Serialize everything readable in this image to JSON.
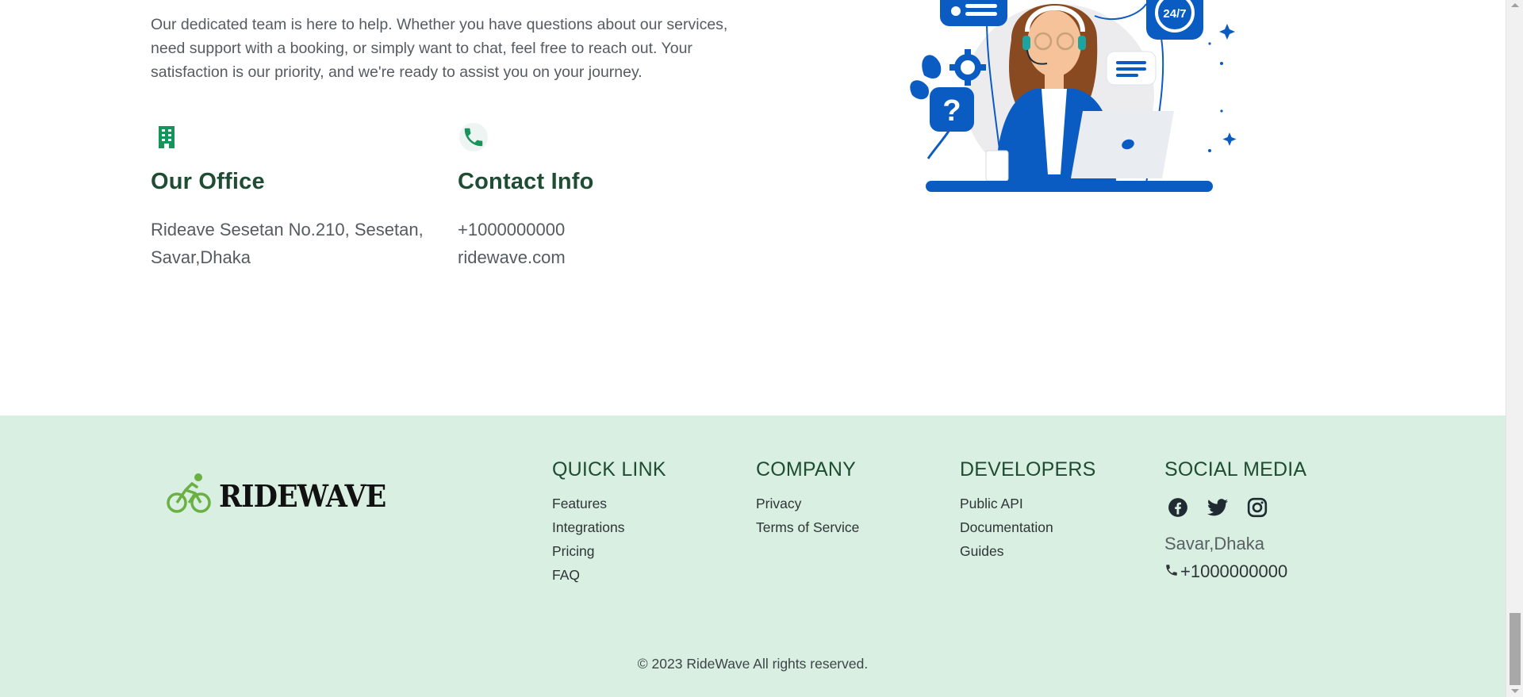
{
  "contact": {
    "intro": "Our dedicated team is here to help. Whether you have questions about our services, need support with a booking, or simply want to chat, feel free to reach out. Your satisfaction is our priority, and we're ready to assist you on your journey.",
    "office": {
      "icon": "building-icon",
      "title": "Our Office",
      "address_line1": "Rideave Sesetan No.210, Sesetan,",
      "address_line2": "Savar,Dhaka"
    },
    "info": {
      "icon": "phone-icon",
      "title": "Contact Info",
      "phone": "+1000000000",
      "website": "ridewave.com"
    },
    "illustration": {
      "badge_text": "24/7",
      "question_mark": "?"
    }
  },
  "footer": {
    "brand": "RIDEWAVE",
    "quick_link": {
      "title": "QUICK LINK",
      "items": [
        "Features",
        "Integrations",
        "Pricing",
        "FAQ"
      ]
    },
    "company": {
      "title": "COMPANY",
      "items": [
        "Privacy",
        "Terms of Service"
      ]
    },
    "developers": {
      "title": "DEVELOPERS",
      "items": [
        "Public API",
        "Documentation",
        "Guides"
      ]
    },
    "social": {
      "title": "SOCIAL MEDIA",
      "icons": [
        "facebook-icon",
        "twitter-icon",
        "instagram-icon"
      ],
      "address": "Savar,Dhaka",
      "phone": "+1000000000"
    },
    "copyright": "© 2023 RideWave All rights reserved."
  },
  "colors": {
    "heading_green": "#1e4d33",
    "footer_bg": "#d8efe1",
    "icon_green": "#17935c",
    "illus_blue": "#0a5cc2"
  }
}
